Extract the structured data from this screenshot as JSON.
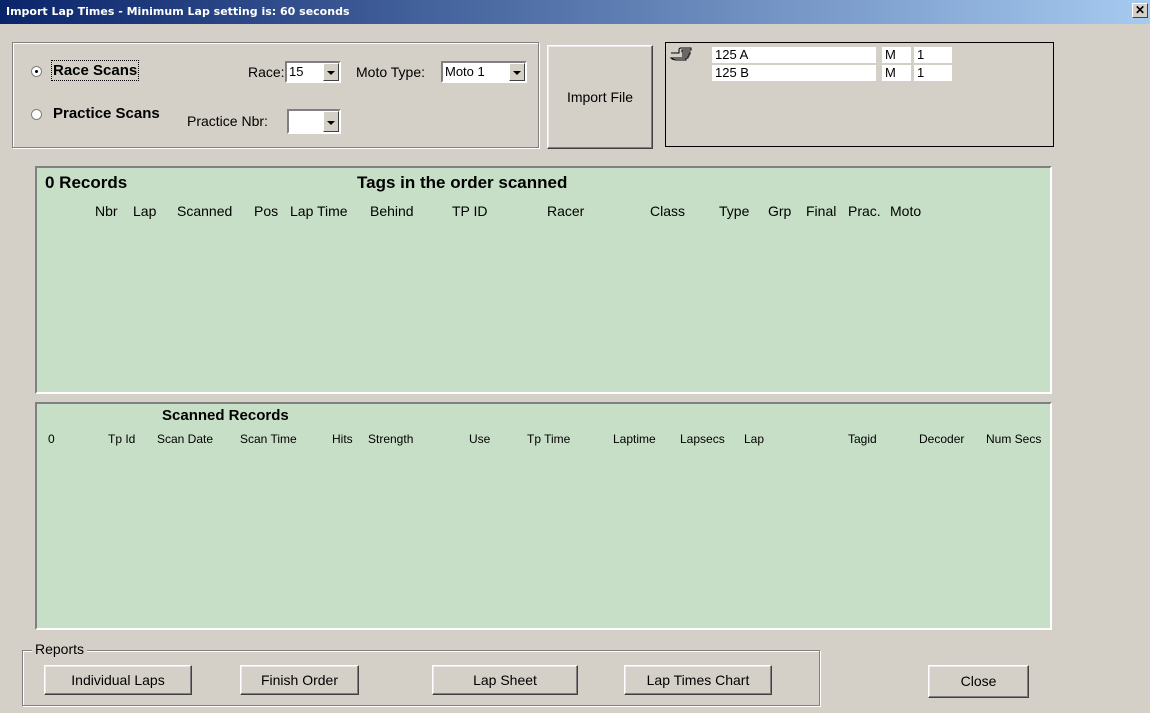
{
  "window": {
    "title": "Import Lap Times - Minimum Lap setting is: 60 seconds",
    "close_glyph": "✕"
  },
  "scan_mode": {
    "race_label": "Race Scans",
    "practice_label": "Practice Scans",
    "selected": "race",
    "race_field_label": "Race:",
    "race_value": "15",
    "moto_type_label": "Moto Type:",
    "moto_type_value": "Moto 1",
    "practice_nbr_label": "Practice Nbr:",
    "practice_nbr_value": ""
  },
  "import_button_label": "Import File",
  "classes": {
    "pointer_icon": "hand-pointer-icon",
    "rows": [
      {
        "name": "125 A",
        "type": "M",
        "num": "1"
      },
      {
        "name": "125 B",
        "type": "M",
        "num": "1"
      }
    ]
  },
  "tags_panel": {
    "record_count": "0 Records",
    "title": "Tags in the order scanned",
    "columns": [
      "Nbr",
      "Lap",
      "Scanned",
      "Pos",
      "Lap Time",
      "Behind",
      "TP ID",
      "Racer",
      "Class",
      "Type",
      "Grp",
      "Final",
      "Prac.",
      "Moto"
    ]
  },
  "scanned_panel": {
    "title": "Scanned Records",
    "count": "0",
    "columns": [
      "Tp Id",
      "Scan Date",
      "Scan Time",
      "Hits",
      "Strength",
      "Use",
      "Tp Time",
      "Laptime",
      "Lapsecs",
      "Lap",
      "Tagid",
      "Decoder",
      "Num Secs"
    ]
  },
  "reports": {
    "legend": "Reports",
    "buttons": [
      "Individual Laps",
      "Finish Order",
      "Lap Sheet",
      "Lap Times Chart"
    ]
  },
  "close_button_label": "Close",
  "colors": {
    "panel_green": "#c6dfc6",
    "dialog_gray": "#d4d0c8",
    "titlebar_start": "#0a246a",
    "titlebar_end": "#a6caf0"
  }
}
